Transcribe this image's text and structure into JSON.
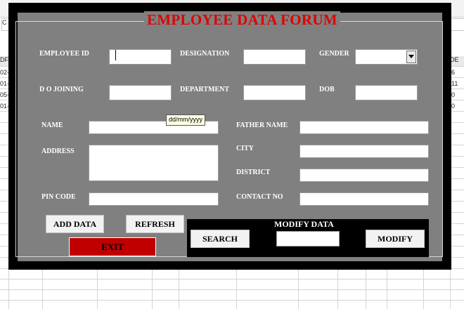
{
  "background": {
    "ribbon_cell": "C",
    "header_left": "DF",
    "header_right": "DE",
    "left_values": [
      "02-",
      "01-",
      "05-",
      "01-"
    ],
    "right_values": [
      "6",
      "11",
      "0",
      "0"
    ]
  },
  "form": {
    "title": "EMPLOYEE DATA FORUM",
    "labels": {
      "employee_id": "EMPLOYEE ID",
      "designation": "DESIGNATION",
      "gender": "GENDER",
      "date_of_joining": "D O JOINING",
      "department": "DEPARTMENT",
      "dob": "DOB",
      "name": "NAME",
      "father_name": "FATHER NAME",
      "address": "ADDRESS",
      "city": "CITY",
      "district": "DISTRICT",
      "pin_code": "PIN CODE",
      "contact_no": "CONTACT NO"
    },
    "values": {
      "employee_id": "",
      "designation": "",
      "gender": "",
      "date_of_joining": "",
      "department": "",
      "dob": "",
      "name": "",
      "father_name": "",
      "address": "",
      "city": "",
      "district": "",
      "pin_code": "",
      "contact_no": "",
      "modify_search": ""
    },
    "tooltip": "dd/mm/yyyy",
    "buttons": {
      "add_data": "ADD DATA",
      "refresh": "REFRESH",
      "exit": "EXIT",
      "search": "SEARCH",
      "modify": "MODIFY"
    },
    "modify_section_title": "MODIFY DATA",
    "icons": {
      "gender_dropdown": "chevron-down-icon"
    },
    "colors": {
      "window_border": "#000000",
      "form_background": "#808080",
      "title_text": "#e00000",
      "exit_button": "#c00000",
      "label_text": "#ffffff"
    }
  }
}
